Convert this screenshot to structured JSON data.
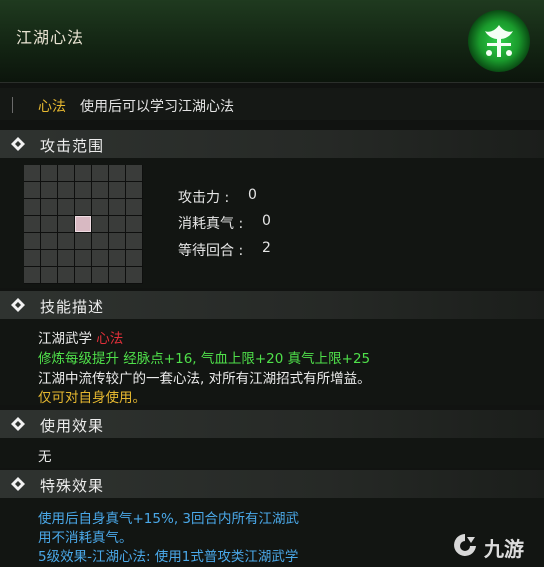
{
  "header": {
    "title": "江湖心法"
  },
  "type_row": {
    "kind": "心法",
    "description": "使用后可以学习江湖心法"
  },
  "attack_range": {
    "heading": "攻击范围",
    "grid": {
      "rows": 7,
      "cols": 7,
      "selected": [
        [
          3,
          3
        ]
      ]
    },
    "stats": [
      {
        "label": "攻击力 :",
        "value": "0"
      },
      {
        "label": "消耗真气 :",
        "value": "0"
      },
      {
        "label": "等待回合 :",
        "value": "2"
      }
    ]
  },
  "skill_desc": {
    "heading": "技能描述",
    "line1_prefix": "江湖武学",
    "line1_tag": "心法",
    "line2": "修炼每级提升 经脉点+16, 气血上限+20 真气上限+25",
    "line3": "江湖中流传较广的一套心法, 对所有江湖招式有所增益。",
    "line4": "仅可对自身使用。"
  },
  "use_effect": {
    "heading": "使用效果",
    "text": "无"
  },
  "special_effect": {
    "heading": "特殊效果",
    "line1": "使用后自身真气+15%, 3回合内所有江湖武",
    "line2": "用不消耗真气。",
    "line3": "5级效果-江湖心法: 使用1式普攻类江湖武学"
  },
  "watermark": {
    "text": "九游"
  },
  "colors": {
    "accent_gold": "#e6b830",
    "tag_red": "#e0303a",
    "bonus_green": "#4fe04a",
    "effect_blue": "#4aa8e8"
  }
}
